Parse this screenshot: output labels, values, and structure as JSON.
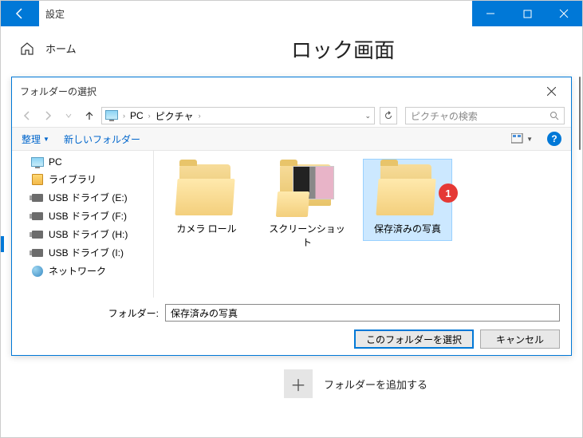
{
  "titlebar": {
    "title": "設定"
  },
  "home": {
    "label": "ホーム"
  },
  "page": {
    "title": "ロック画面"
  },
  "dialog": {
    "title": "フォルダーの選択",
    "breadcrumb": {
      "root": "PC",
      "folder": "ピクチャ"
    },
    "search_placeholder": "ピクチャの検索",
    "toolbar": {
      "organize": "整理",
      "new_folder": "新しいフォルダー"
    },
    "tree": {
      "pc": "PC",
      "library": "ライブラリ",
      "usb_e": "USB ドライブ (E:)",
      "usb_f": "USB ドライブ (F:)",
      "usb_h": "USB ドライブ (H:)",
      "usb_i": "USB ドライブ (I:)",
      "network": "ネットワーク"
    },
    "folders": {
      "camera_roll": "カメラ ロール",
      "screenshots": "スクリーンショット",
      "saved_pictures": "保存済みの写真"
    },
    "badge": "1",
    "footer": {
      "folder_label": "フォルダー:",
      "folder_value": "保存済みの写真",
      "select_btn": "このフォルダーを選択",
      "cancel_btn": "キャンセル"
    }
  },
  "add_folder": {
    "label": "フォルダーを追加する"
  }
}
